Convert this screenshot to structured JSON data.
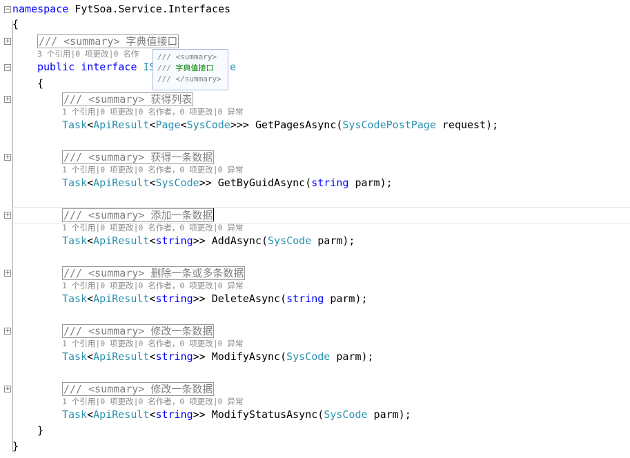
{
  "code": {
    "namespace_kw": "namespace",
    "namespace_name": " FytSoa.Service.Interfaces",
    "open_brace": "{",
    "close_brace": "}",
    "interface": {
      "summary": "/// <summary> 字典值接口",
      "lens": "3 个引用|0 项更改|0 名作",
      "kw_public": "public",
      "kw_interface": " interface",
      "name_visible_start": " IS",
      "name_visible_end": "e"
    },
    "tooltip": {
      "line1": "/// <summary>",
      "line2_prefix": "/// ",
      "line2_text": "字典值接口",
      "line3": "/// </summary>"
    },
    "methods": [
      {
        "summary": "/// <summary> 获得列表",
        "lens": "1 个引用|0 项更改|0 名作者，0 项更改|0 异常",
        "t1": "Task",
        "t2": "ApiResult",
        "t3": "Page",
        "t4": "SysCode",
        "mid": ">>> GetPagesAsync(",
        "ptype": "SysCodePostPage",
        "rest": " request);"
      },
      {
        "summary": "/// <summary> 获得一条数据",
        "lens": "1 个引用|0 项更改|0 名作者，0 项更改|0 异常",
        "t1": "Task",
        "t2": "ApiResult",
        "t3": "SysCode",
        "mid": ">> GetByGuidAsync(",
        "pkw": "string",
        "rest": " parm);"
      },
      {
        "summary": "/// <summary> 添加一条数据",
        "lens": "1 个引用|0 项更改|0 名作者，0 项更改|0 异常",
        "t1": "Task",
        "t2": "ApiResult",
        "t3": "string",
        "mid": ">> AddAsync(",
        "ptype": "SysCode",
        "rest": " parm);"
      },
      {
        "summary": "/// <summary> 删除一条或多条数据",
        "lens": "1 个引用|0 项更改|0 名作者，0 项更改|0 异常",
        "t1": "Task",
        "t2": "ApiResult",
        "t3": "string",
        "mid": ">> DeleteAsync(",
        "pkw": "string",
        "rest": " parm);"
      },
      {
        "summary": "/// <summary> 修改一条数据",
        "lens": "1 个引用|0 项更改|0 名作者，0 项更改|0 异常",
        "t1": "Task",
        "t2": "ApiResult",
        "t3": "string",
        "mid": ">> ModifyAsync(",
        "ptype": "SysCode",
        "rest": " parm);"
      },
      {
        "summary": "/// <summary> 修改一条数据",
        "lens": "1 个引用|0 项更改|0 名作者，0 项更改|0 异常",
        "t1": "Task",
        "t2": "ApiResult",
        "t3": "string",
        "mid": ">> ModifyStatusAsync(",
        "ptype": "SysCode",
        "rest": " parm);"
      }
    ]
  },
  "glyphs": {
    "minus": "−",
    "plus": "+",
    "lt": "<"
  },
  "colors": {
    "keyword": "#0000ff",
    "type": "#2b91af",
    "comment": "#808080",
    "lens": "#8a8a8a"
  }
}
